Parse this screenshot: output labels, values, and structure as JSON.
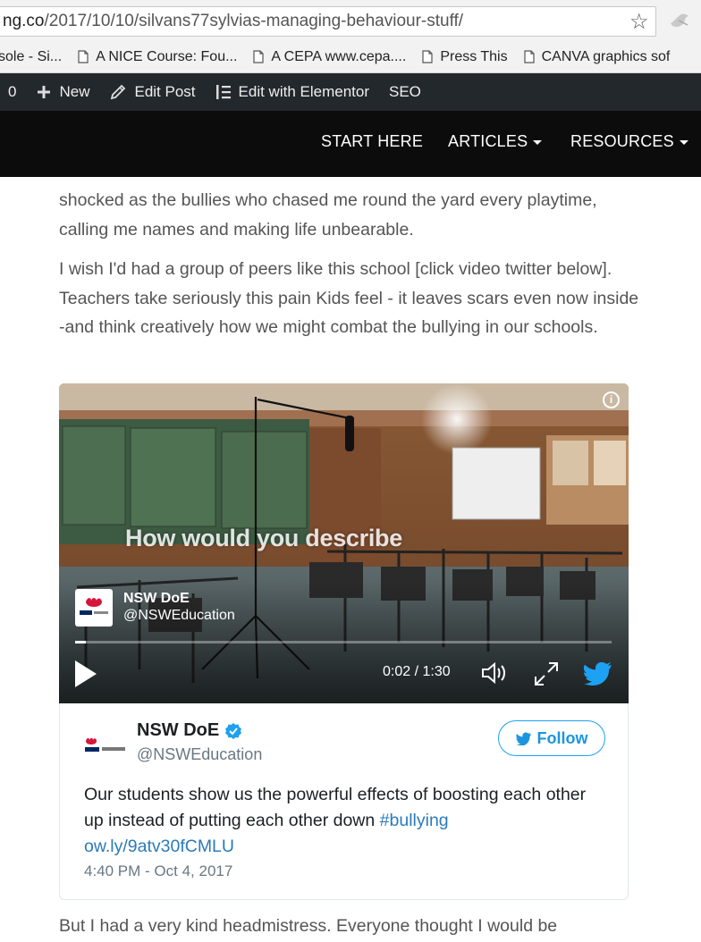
{
  "browser": {
    "url_domain": "ng.co",
    "url_path": "/2017/10/10/silvans77sylvias-managing-behaviour-stuff/",
    "bookmarks": [
      "sole - Si...",
      "A NICE Course: Fou...",
      "A CEPA  www.cepa....",
      "Press This",
      "CANVA graphics sof"
    ]
  },
  "adminbar": {
    "count": "0",
    "new_label": "New",
    "edit_post_label": "Edit Post",
    "elementor_label": "Edit with Elementor",
    "seo_label": "SEO"
  },
  "nav": {
    "start_here": "START HERE",
    "articles": "ARTICLES",
    "resources": "RESOURCES"
  },
  "article": {
    "line1": "shocked as the bullies who chased me round the yard every playtime,",
    "line2": "calling me names and making life unbearable.",
    "para2": "I wish I'd had a group of peers like this school [click video twitter below]. Teachers take seriously this pain Kids feel - it leaves scars even now inside -and think creatively how we might combat the bullying in our schools.",
    "para3": "But I had a very kind headmistress. Everyone thought I would be"
  },
  "video": {
    "caption": "How would you describe",
    "author_name": "NSW DoE",
    "author_handle": "@NSWEducation",
    "time": "0:02 / 1:30",
    "progress": 0.02
  },
  "tweet": {
    "name": "NSW DoE",
    "handle": "@NSWEducation",
    "follow_label": "Follow",
    "text_before": "Our students show us the powerful effects of boosting each other up instead of putting each other down ",
    "hashtag": "#bullying",
    "link": "ow.ly/9atv30fCMLU",
    "timestamp": "4:40 PM - Oct 4, 2017"
  },
  "colors": {
    "admin_bar": "#23282d",
    "site_nav": "#0c0c0c",
    "twitter_blue": "#1da1f2",
    "link_blue": "#2b7bb9"
  }
}
